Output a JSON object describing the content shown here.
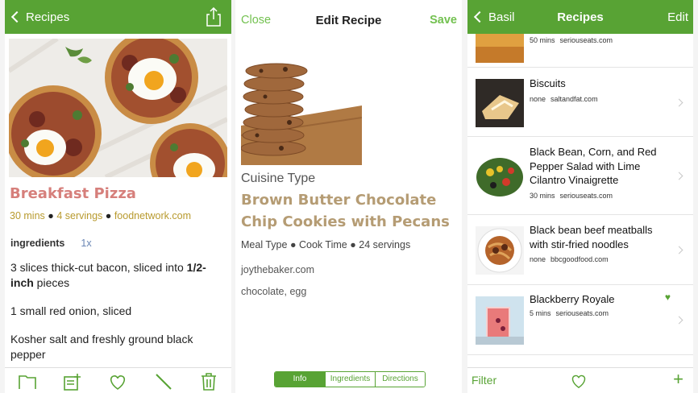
{
  "screen1": {
    "back_label": "Recipes",
    "title": "Breakfast Pizza",
    "time": "30 mins",
    "servings": "4 servings",
    "source": "foodnetwork.com",
    "ingredients_label": "ingredients",
    "multiplier": "1x",
    "ingredients": [
      {
        "pre": "3 slices thick-cut bacon, sliced into ",
        "bold": "1/2-inch",
        "post": " pieces"
      },
      {
        "pre": "1 small red onion, sliced",
        "bold": "",
        "post": ""
      },
      {
        "pre": "Kosher salt and freshly ground black pepper",
        "bold": "",
        "post": ""
      }
    ]
  },
  "screen2": {
    "close_label": "Close",
    "title": "Edit Recipe",
    "save_label": "Save",
    "cuisine": "Cuisine Type",
    "recipe_title": "Brown Butter Chocolate Chip Cookies with Pecans",
    "meal_type": "Meal Type",
    "cook_time": "Cook Time",
    "servings": "24 servings",
    "source": "joythebaker.com",
    "ingredients": "chocolate, egg",
    "tabs": [
      "Info",
      "Ingredients",
      "Directions"
    ]
  },
  "screen3": {
    "back_label": "Basil",
    "title": "Recipes",
    "edit_label": "Edit",
    "items": [
      {
        "name": "",
        "time": "50 mins",
        "source": "seriouseats.com"
      },
      {
        "name": "Biscuits",
        "time": "none",
        "source": "saltandfat.com"
      },
      {
        "name": "Black Bean, Corn, and Red Pepper Salad with Lime Cilantro Vinaigrette",
        "time": "30 mins",
        "source": "seriouseats.com"
      },
      {
        "name": "Black bean beef meatballs with stir-fried noodles",
        "time": "none",
        "source": "bbcgoodfood.com"
      },
      {
        "name": "Blackberry Royale",
        "time": "5 mins",
        "source": "seriouseats.com"
      }
    ],
    "filter_label": "Filter",
    "plus_label": "+"
  },
  "colors": {
    "accent": "#58a334",
    "title_pink": "#d67f7b",
    "title_tan": "#b59c74",
    "meta_gold": "#b89a2e"
  }
}
